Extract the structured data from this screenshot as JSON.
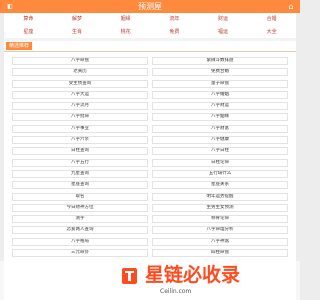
{
  "header": {
    "logo": "◧",
    "title": "预测屋",
    "home_icon": "⌂"
  },
  "nav": {
    "items": [
      {
        "label": "算命"
      },
      {
        "label": "解梦"
      },
      {
        "label": "姻缘"
      },
      {
        "label": "流年"
      },
      {
        "label": "财运"
      },
      {
        "label": "合婚"
      },
      {
        "label": "星座"
      },
      {
        "label": "生肖"
      },
      {
        "label": "桃花"
      },
      {
        "label": "免费"
      },
      {
        "label": "福运"
      },
      {
        "label": "大全"
      }
    ]
  },
  "section": {
    "title": "精选推荐"
  },
  "list": [
    {
      "label": "八字命盘"
    },
    {
      "label": "紫微斗数排盘"
    },
    {
      "label": "老黄历"
    },
    {
      "label": "免费合婚"
    },
    {
      "label": "受生债查询"
    },
    {
      "label": "量子命盘"
    },
    {
      "label": "八字大运"
    },
    {
      "label": "八字婚姻"
    },
    {
      "label": "八字流月"
    },
    {
      "label": "八字财运"
    },
    {
      "label": "八字批命"
    },
    {
      "label": "八字姻缘"
    },
    {
      "label": "八字事业"
    },
    {
      "label": "八字财富"
    },
    {
      "label": "八字六亲"
    },
    {
      "label": "八字健康"
    },
    {
      "label": "日柱查询"
    },
    {
      "label": "八字日柱"
    },
    {
      "label": "八字五行"
    },
    {
      "label": "日柱论命"
    },
    {
      "label": "九星查询"
    },
    {
      "label": "五行缺什么"
    },
    {
      "label": "星座查询"
    },
    {
      "label": "星座关系"
    },
    {
      "label": "取名"
    },
    {
      "label": "明年运势提醒"
    },
    {
      "label": "今日财神方位"
    },
    {
      "label": "生男生女预测"
    },
    {
      "label": "测字"
    },
    {
      "label": "称骨论命"
    },
    {
      "label": "恋爱两人查询"
    },
    {
      "label": "八字命理分析"
    },
    {
      "label": "八字格局"
    },
    {
      "label": "八字神煞"
    },
    {
      "label": "三元命卦"
    },
    {
      "label": "四柱命盘"
    }
  ],
  "footer": {
    "watermark": "星链必收录",
    "link": "Ceilin.com"
  }
}
